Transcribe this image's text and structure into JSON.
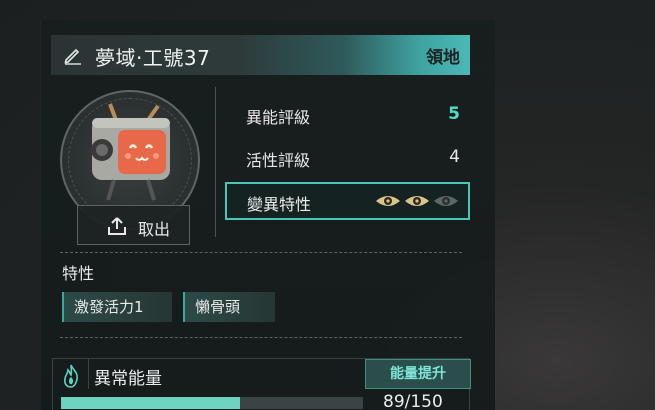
{
  "header": {
    "title": "夢域·工號37",
    "territory_label": "領地",
    "edit_icon": "pencil-icon"
  },
  "unit": {
    "portrait": "robot-tv-head-avatar",
    "take_out_label": "取出",
    "take_out_icon": "upload-icon"
  },
  "stats": [
    {
      "label": "異能評級",
      "value": "5",
      "value_color": "#4fe0c9"
    },
    {
      "label": "活性評級",
      "value": "4",
      "value_color": "#e8e8e8"
    }
  ],
  "mutation": {
    "label": "變異特性",
    "eyes": [
      {
        "icon": "eye-icon",
        "active": true
      },
      {
        "icon": "eye-icon",
        "active": true
      },
      {
        "icon": "eye-icon",
        "active": false
      }
    ]
  },
  "traits": {
    "title": "特性",
    "items": [
      "激發活力1",
      "懶骨頭"
    ]
  },
  "energy": {
    "icon": "flame-icon",
    "label": "異常能量",
    "boost_label": "能量提升",
    "current": 89,
    "max": 150,
    "display": "89/150"
  },
  "colors": {
    "accent": "#48c6b7",
    "fill": "#6fd3c1",
    "eye_active": "#d9c58a",
    "eye_inactive": "#5f6666"
  }
}
